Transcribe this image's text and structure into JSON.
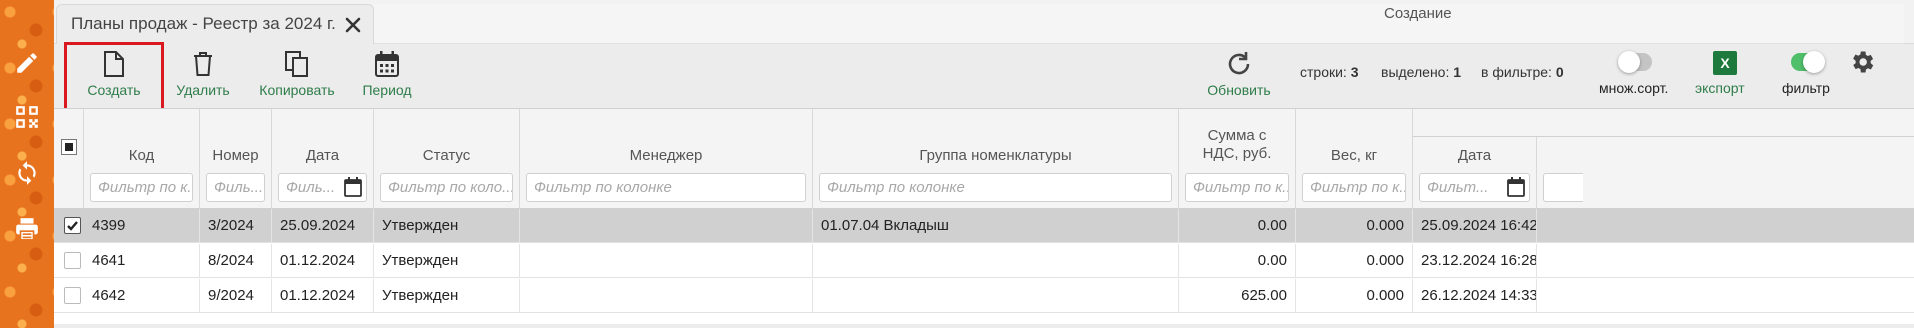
{
  "tab": {
    "title": "Планы продаж - Реестр за 2024 г."
  },
  "toolbar": {
    "create": "Создать",
    "delete": "Удалить",
    "copy": "Копировать",
    "period": "Период",
    "refresh": "Обновить",
    "rows_label": "строки:",
    "rows_value": "3",
    "selected_label": "выделено:",
    "selected_value": "1",
    "in_filter_label": "в фильтре:",
    "in_filter_value": "0",
    "multisort": "множ.сорт.",
    "export": "экспорт",
    "filter": "фильтр",
    "multisort_on": false,
    "filter_on": true
  },
  "colors": {
    "accent_green": "#2e7d4a",
    "highlight_red": "#d9181f",
    "sidebar_orange": "#e8731e"
  },
  "table": {
    "group_header": "Создание",
    "columns": [
      {
        "key": "code",
        "title": "Код",
        "filter": "Фильтр по к..."
      },
      {
        "key": "number",
        "title": "Номер",
        "filter": "Филь..."
      },
      {
        "key": "date",
        "title": "Дата",
        "filter": "Филь..."
      },
      {
        "key": "status",
        "title": "Статус",
        "filter": "Фильтр по коло..."
      },
      {
        "key": "manager",
        "title": "Менеджер",
        "filter": "Фильтр по колонке"
      },
      {
        "key": "group",
        "title": "Группа номенклатуры",
        "filter": "Фильтр по колонке"
      },
      {
        "key": "sum",
        "title": "Сумма с НДС, руб.",
        "filter": "Фильтр по к..."
      },
      {
        "key": "weight",
        "title": "Вес, кг",
        "filter": "Фильтр по к..."
      },
      {
        "key": "created_date",
        "title": "Дата",
        "filter": "Фильт..."
      }
    ],
    "rows": [
      {
        "selected": true,
        "code": "4399",
        "number": "3/2024",
        "date": "25.09.2024",
        "status": "Утвержден",
        "manager": "",
        "group": "01.07.04 Вкладыш",
        "sum": "0.00",
        "weight": "0.000",
        "created_date": "25.09.2024 16:42"
      },
      {
        "selected": false,
        "code": "4641",
        "number": "8/2024",
        "date": "01.12.2024",
        "status": "Утвержден",
        "manager": "",
        "group": "",
        "sum": "0.00",
        "weight": "0.000",
        "created_date": "23.12.2024 16:28"
      },
      {
        "selected": false,
        "code": "4642",
        "number": "9/2024",
        "date": "01.12.2024",
        "status": "Утвержден",
        "manager": "",
        "group": "",
        "sum": "625.00",
        "weight": "0.000",
        "created_date": "26.12.2024 14:33"
      }
    ]
  },
  "icons": {
    "sidebar": [
      "pencil-icon",
      "qr-code-icon",
      "sync-icon",
      "printer-icon"
    ],
    "toolbar": [
      "new-document-icon",
      "trash-icon",
      "copy-icon",
      "calendar-icon",
      "refresh-icon",
      "excel-icon",
      "gear-icon"
    ]
  }
}
